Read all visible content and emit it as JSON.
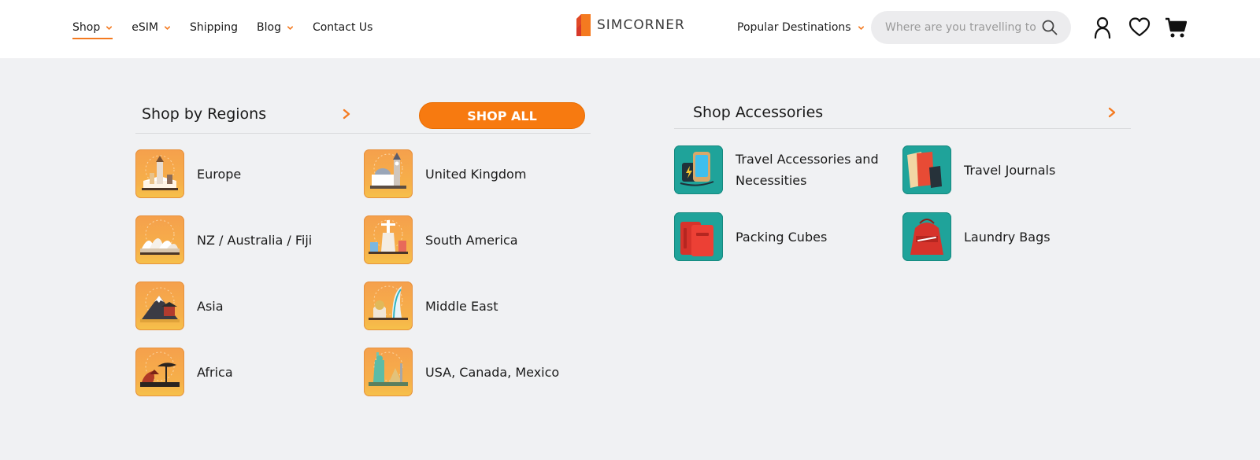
{
  "header": {
    "nav": [
      {
        "label": "Shop",
        "has_dropdown": true,
        "active": true
      },
      {
        "label": "eSIM",
        "has_dropdown": true,
        "active": false
      },
      {
        "label": "Shipping",
        "has_dropdown": false,
        "active": false
      },
      {
        "label": "Blog",
        "has_dropdown": true,
        "active": false
      },
      {
        "label": "Contact Us",
        "has_dropdown": false,
        "active": false
      }
    ],
    "logo_text": "SIMCORNER",
    "popular_destinations": "Popular Destinations",
    "search_placeholder": "Where are you travelling to",
    "icons": [
      "account-icon",
      "wishlist-heart-icon",
      "cart-icon"
    ]
  },
  "regions": {
    "title": "Shop by Regions",
    "shop_all": "SHOP ALL",
    "items": [
      {
        "label": "Europe",
        "icon": "europe-landmarks-icon"
      },
      {
        "label": "United Kingdom",
        "icon": "uk-landmarks-icon"
      },
      {
        "label": "NZ / Australia / Fiji",
        "icon": "sydney-opera-house-icon"
      },
      {
        "label": "South America",
        "icon": "south-america-landmarks-icon"
      },
      {
        "label": "Asia",
        "icon": "asia-mount-fuji-icon"
      },
      {
        "label": "Middle East",
        "icon": "middle-east-landmarks-icon"
      },
      {
        "label": "Africa",
        "icon": "africa-savanna-icon"
      },
      {
        "label": "USA, Canada, Mexico",
        "icon": "statue-of-liberty-icon"
      }
    ]
  },
  "accessories": {
    "title": "Shop Accessories",
    "items": [
      {
        "label": "Travel Accessories and Necessities",
        "icon": "phone-charger-icon"
      },
      {
        "label": "Travel Journals",
        "icon": "journal-icon"
      },
      {
        "label": "Packing Cubes",
        "icon": "packing-cube-icon"
      },
      {
        "label": "Laundry Bags",
        "icon": "laundry-bag-icon"
      }
    ]
  },
  "colors": {
    "accent": "#f77a10",
    "background": "#f0f1f3",
    "teal": "#1fa39a"
  }
}
